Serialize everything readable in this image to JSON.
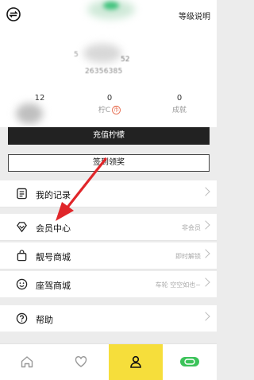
{
  "header": {
    "level_link": "等级说明",
    "line_a": "5",
    "line_b": "52",
    "uid": "26356385"
  },
  "stats": [
    {
      "value": "12",
      "label": ""
    },
    {
      "value": "0",
      "label": "柠C",
      "badge": "币"
    },
    {
      "value": "0",
      "label": "成就"
    }
  ],
  "buttons": {
    "recharge": "充值柠檬",
    "signin": "签到领奖"
  },
  "menu": [
    {
      "label": "我的记录",
      "icon": "list-icon",
      "sub": ""
    },
    {
      "label": "会员中心",
      "icon": "vip-diamond-icon",
      "sub": "非会员"
    },
    {
      "label": "靓号商城",
      "icon": "bag-icon",
      "sub": "即时解锁"
    },
    {
      "label": "座驾商城",
      "icon": "smile-icon",
      "sub": "车轮 空空如也~"
    },
    {
      "label": "帮助",
      "icon": "help-icon",
      "sub": ""
    }
  ],
  "tabs": [
    {
      "name": "home",
      "icon": "home-icon",
      "active": false
    },
    {
      "name": "favorites",
      "icon": "heart-icon",
      "active": false
    },
    {
      "name": "profile",
      "icon": "person-icon",
      "active": true
    },
    {
      "name": "toggle",
      "icon": "toggle-icon",
      "active": false
    }
  ],
  "colors": {
    "accent": "#f6de3b",
    "arrow": "#e0262a",
    "dark_button": "#222222",
    "toggle_green": "#3cc35a"
  }
}
